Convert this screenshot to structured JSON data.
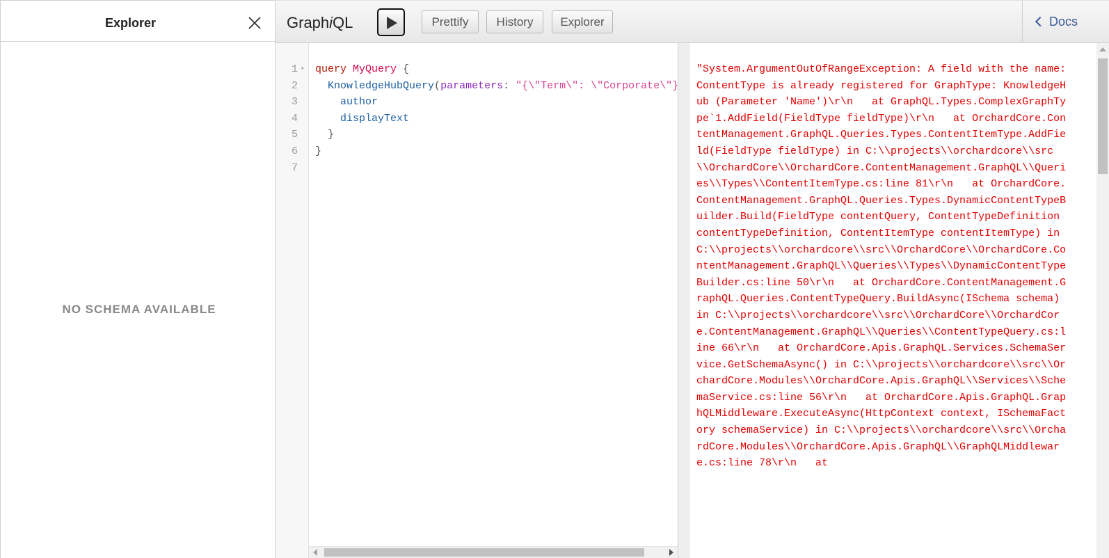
{
  "explorer": {
    "title": "Explorer",
    "empty_message": "NO SCHEMA AVAILABLE"
  },
  "toolbar": {
    "brand_prefix": "Graph",
    "brand_italic": "i",
    "brand_suffix": "QL",
    "prettify_label": "Prettify",
    "history_label": "History",
    "explorer_label": "Explorer",
    "docs_label": "Docs"
  },
  "editor": {
    "lines": [
      {
        "n": "1",
        "tokens": [
          [
            "kw",
            "query"
          ],
          [
            "pun",
            " "
          ],
          [
            "def",
            "MyQuery"
          ],
          [
            "pun",
            " {"
          ]
        ]
      },
      {
        "n": "2",
        "tokens": [
          [
            "pun",
            "  "
          ],
          [
            "fn",
            "KnowledgeHubQuery"
          ],
          [
            "pun",
            "("
          ],
          [
            "attr",
            "parameters"
          ],
          [
            "pun",
            ": "
          ],
          [
            "str",
            "\"{\\\"Term\\\": \\\"Corporate\\\"}\""
          ]
        ]
      },
      {
        "n": "3",
        "tokens": [
          [
            "pun",
            "    "
          ],
          [
            "fn",
            "author"
          ]
        ]
      },
      {
        "n": "4",
        "tokens": [
          [
            "pun",
            "    "
          ],
          [
            "fn",
            "displayText"
          ]
        ]
      },
      {
        "n": "5",
        "tokens": [
          [
            "pun",
            "  }"
          ]
        ]
      },
      {
        "n": "6",
        "tokens": [
          [
            "pun",
            "}"
          ]
        ]
      },
      {
        "n": "7",
        "tokens": []
      }
    ]
  },
  "result": {
    "text": "\"System.ArgumentOutOfRangeException: A field with the name: ContentType is already registered for GraphType: KnowledgeHub (Parameter 'Name')\\r\\n   at GraphQL.Types.ComplexGraphType`1.AddField(FieldType fieldType)\\r\\n   at OrchardCore.ContentManagement.GraphQL.Queries.Types.ContentItemType.AddField(FieldType fieldType) in C:\\\\projects\\\\orchardcore\\\\src\\\\OrchardCore\\\\OrchardCore.ContentManagement.GraphQL\\\\Queries\\\\Types\\\\ContentItemType.cs:line 81\\r\\n   at OrchardCore.ContentManagement.GraphQL.Queries.Types.DynamicContentTypeBuilder.Build(FieldType contentQuery, ContentTypeDefinition contentTypeDefinition, ContentItemType contentItemType) in C:\\\\projects\\\\orchardcore\\\\src\\\\OrchardCore\\\\OrchardCore.ContentManagement.GraphQL\\\\Queries\\\\Types\\\\DynamicContentTypeBuilder.cs:line 50\\r\\n   at OrchardCore.ContentManagement.GraphQL.Queries.ContentTypeQuery.BuildAsync(ISchema schema) in C:\\\\projects\\\\orchardcore\\\\src\\\\OrchardCore\\\\OrchardCore.ContentManagement.GraphQL\\\\Queries\\\\ContentTypeQuery.cs:line 66\\r\\n   at OrchardCore.Apis.GraphQL.Services.SchemaService.GetSchemaAsync() in C:\\\\projects\\\\orchardcore\\\\src\\\\OrchardCore.Modules\\\\OrchardCore.Apis.GraphQL\\\\Services\\\\SchemaService.cs:line 56\\r\\n   at OrchardCore.Apis.GraphQL.GraphQLMiddleware.ExecuteAsync(HttpContext context, ISchemaFactory schemaService) in C:\\\\projects\\\\orchardcore\\\\src\\\\OrchardCore.Modules\\\\OrchardCore.Apis.GraphQL\\\\GraphQLMiddleware.cs:line 78\\r\\n   at"
  },
  "colors": {
    "error": "#e00000",
    "keyword": "#b11a04",
    "def": "#d2054e",
    "field": "#1f61a0",
    "attribute": "#8b2bb9",
    "string": "#d64292",
    "docs_link": "#3b5998"
  }
}
